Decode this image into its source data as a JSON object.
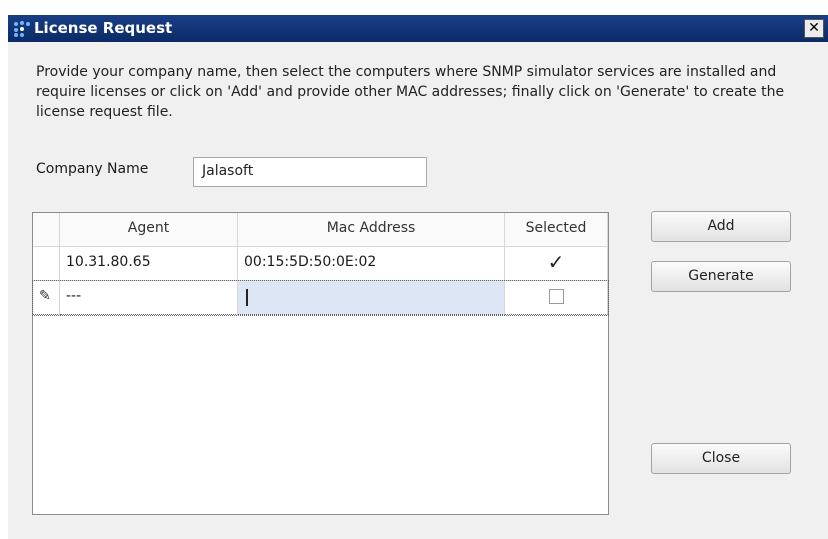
{
  "window": {
    "title": "License Request",
    "close_glyph": "✕"
  },
  "description": "Provide your company name, then select the computers where SNMP simulator services are installed and require licenses or click on 'Add' and provide other MAC addresses; finally click on 'Generate' to create the license request file.",
  "company": {
    "label": "Company Name",
    "value": "Jalasoft"
  },
  "grid": {
    "columns": [
      "Agent",
      "Mac Address",
      "Selected"
    ],
    "rows": [
      {
        "agent": "10.31.80.65",
        "mac": "00:15:5D:50:0E:02",
        "selected": true
      }
    ],
    "new_row": {
      "agent": "---",
      "mac": "",
      "selected": false,
      "indicator": "✎"
    }
  },
  "buttons": {
    "add": "Add",
    "generate": "Generate",
    "close": "Close"
  },
  "colors": {
    "titlebar": "#0b2a66",
    "editing_cell": "#dce6f5"
  },
  "icons": {
    "app": "license-app-icon",
    "close": "close-icon",
    "row_edit": "pencil-icon",
    "check": "checkmark-icon"
  }
}
